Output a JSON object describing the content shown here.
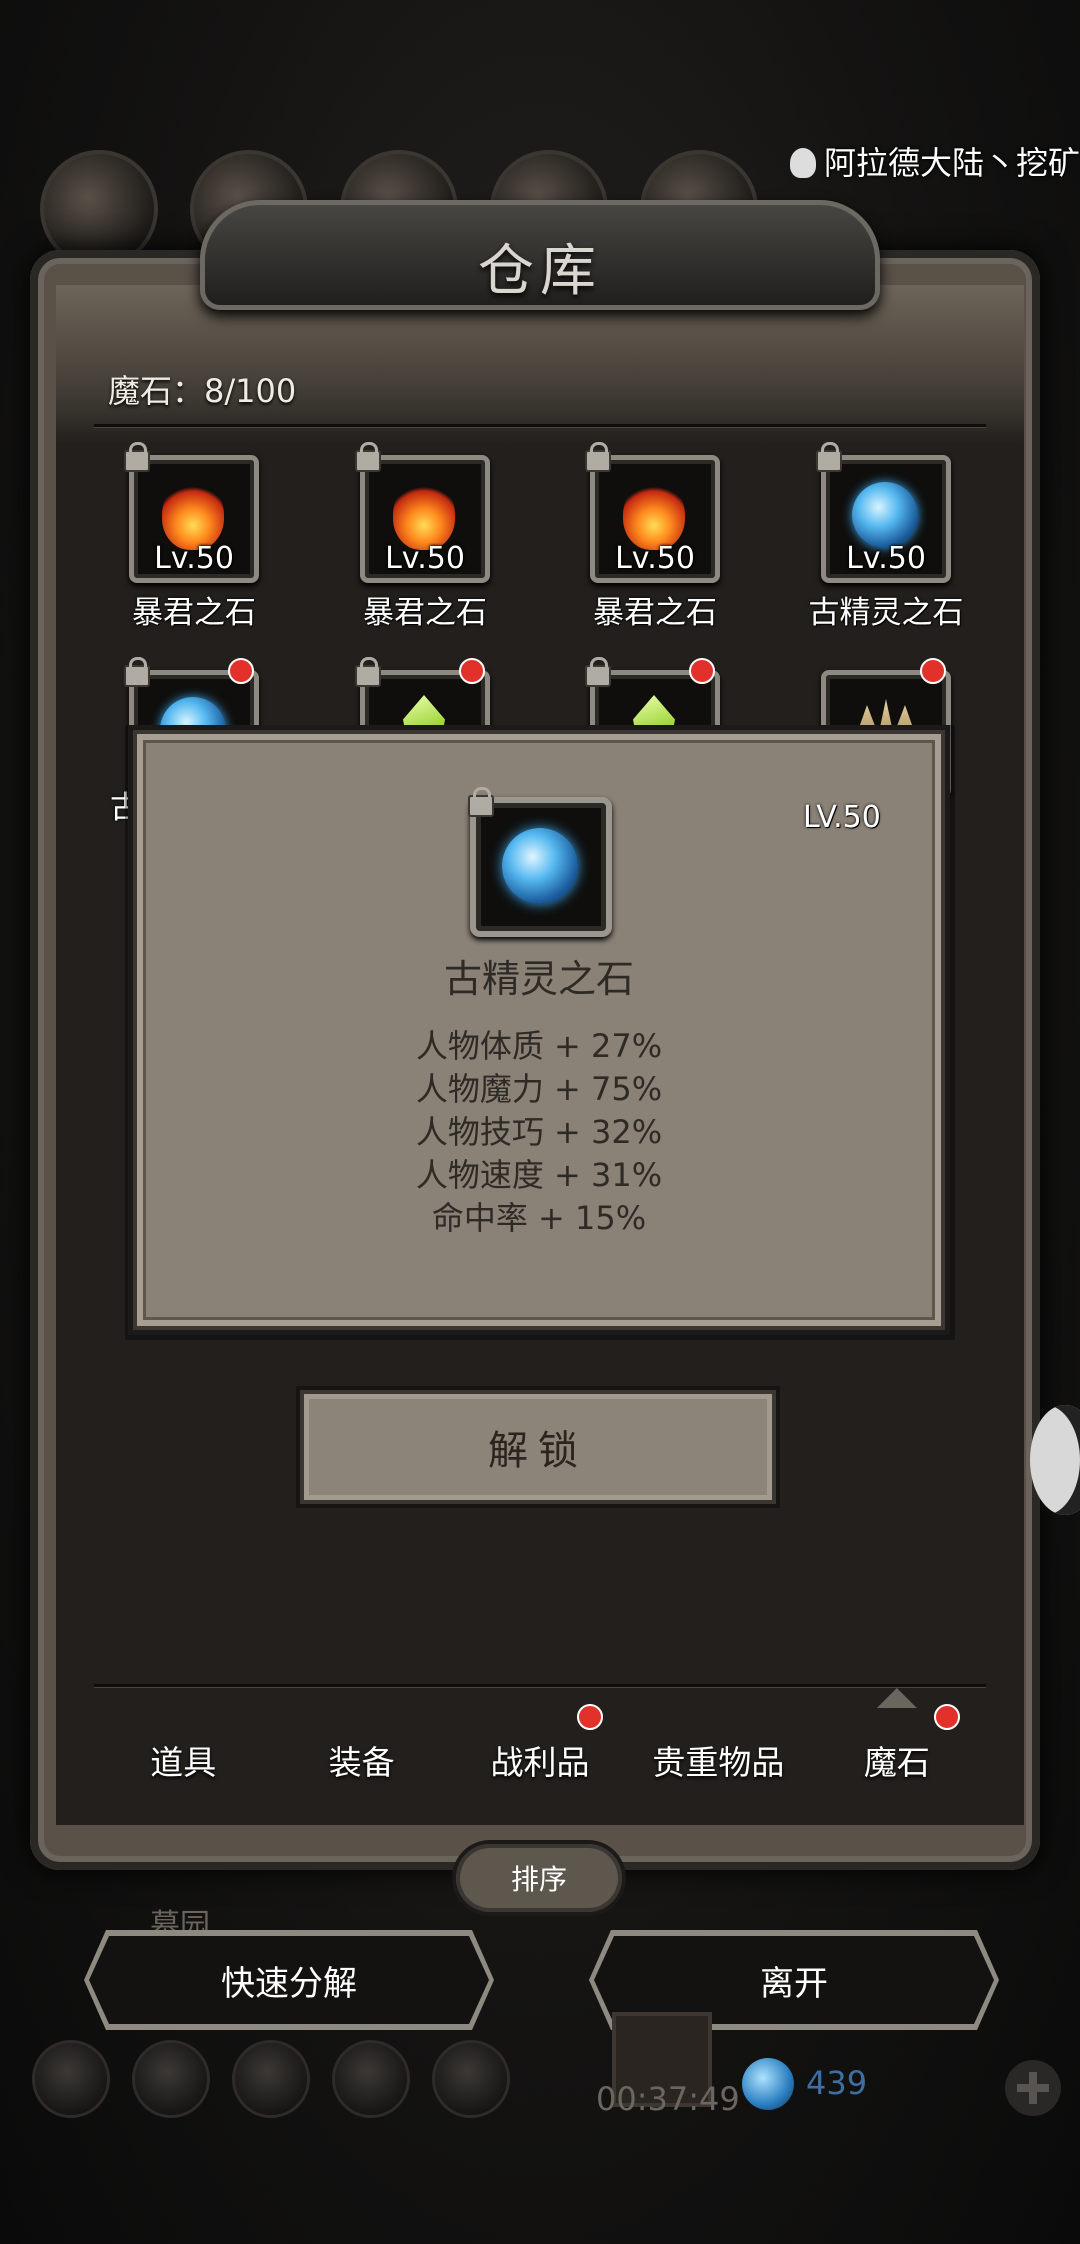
{
  "header": {
    "server_name": "阿拉德大陆丶挖矿"
  },
  "window": {
    "title": "仓库",
    "stone_count_label": "魔石：8/100"
  },
  "items": [
    {
      "name": "暴君之石",
      "level": "Lv.50",
      "gem": "fire",
      "locked": true,
      "badge": false
    },
    {
      "name": "暴君之石",
      "level": "Lv.50",
      "gem": "fire",
      "locked": true,
      "badge": false
    },
    {
      "name": "暴君之石",
      "level": "Lv.50",
      "gem": "fire",
      "locked": true,
      "badge": false
    },
    {
      "name": "古精灵之石",
      "level": "Lv.50",
      "gem": "blue",
      "locked": true,
      "badge": false
    },
    {
      "name": "古",
      "gem": "blue",
      "locked": true,
      "badge": true
    },
    {
      "gem": "green",
      "locked": true,
      "badge": true
    },
    {
      "gem": "green",
      "locked": true,
      "badge": true
    },
    {
      "gem": "horn",
      "locked": false,
      "badge": true
    }
  ],
  "popup": {
    "level": "LV.50",
    "item_name": "古精灵之石",
    "stats": [
      "人物体质 + 27%",
      "人物魔力 + 75%",
      "人物技巧 + 32%",
      "人物速度 + 31%",
      "命中率 + 15%"
    ],
    "unlock_label": "解锁"
  },
  "tabs": [
    {
      "label": "道具",
      "badge": false,
      "active": false
    },
    {
      "label": "装备",
      "badge": false,
      "active": false
    },
    {
      "label": "战利品",
      "badge": true,
      "active": false
    },
    {
      "label": "贵重物品",
      "badge": false,
      "active": false
    },
    {
      "label": "魔石",
      "badge": true,
      "active": true
    }
  ],
  "sort_label": "排序",
  "background_label": "墓园",
  "actions": {
    "quick_decompose_label": "快速分解",
    "leave_label": "离开"
  },
  "footer": {
    "timer": "00:37:49",
    "gem_count": "439"
  },
  "colors": {
    "badge_red": "#e2302a",
    "parchment": "#8b8277",
    "frame_dark": "#221f1c"
  }
}
